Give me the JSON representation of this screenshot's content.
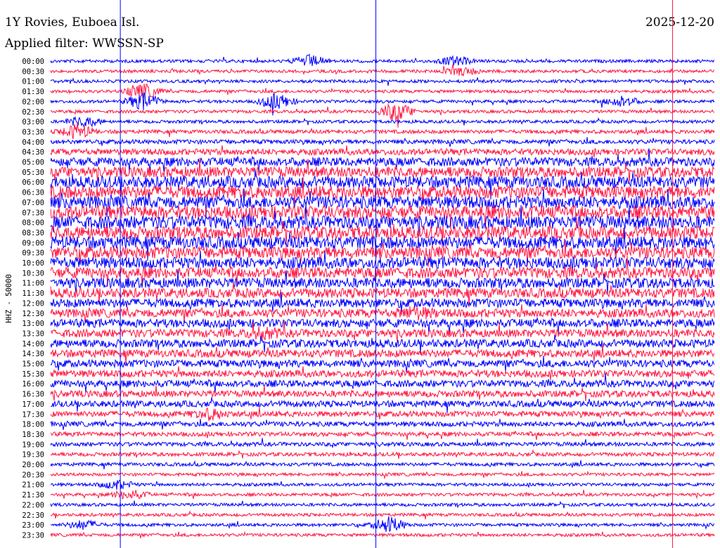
{
  "header": {
    "station": "1Y Rovies, Euboea Isl.",
    "date": "2025-12-20",
    "filter": "Applied filter: WWSSN-SP"
  },
  "chart_data": {
    "type": "line",
    "chart_kind": "helicorder",
    "title": "1Y Rovies, Euboea Isl.",
    "date": "2025-12-20",
    "filter": "Applied filter: WWSSN-SP",
    "ylabel": "HHZ - 50000",
    "grid": false,
    "trace_colors": [
      "#0000ff",
      "#ff1744"
    ],
    "tick_labels": [
      "00:00",
      "00:30",
      "01:00",
      "01:30",
      "02:00",
      "02:30",
      "03:00",
      "03:30",
      "04:00",
      "04:30",
      "05:00",
      "05:30",
      "06:00",
      "06:30",
      "07:00",
      "07:30",
      "08:00",
      "08:30",
      "09:00",
      "09:30",
      "10:00",
      "10:30",
      "11:00",
      "11:30",
      "12:00",
      "12:30",
      "13:00",
      "13:30",
      "14:00",
      "14:30",
      "15:00",
      "15:30",
      "16:00",
      "16:30",
      "17:00",
      "17:30",
      "18:00",
      "18:30",
      "19:00",
      "19:30",
      "20:00",
      "20:30",
      "21:00",
      "21:30",
      "22:00",
      "22:30",
      "23:00",
      "23:30"
    ],
    "row_amplitude": [
      1.0,
      1.0,
      1.0,
      1.0,
      1.0,
      1.0,
      1.0,
      1.2,
      1.4,
      2.0,
      2.8,
      3.4,
      3.8,
      4.0,
      4.1,
      4.2,
      4.2,
      4.1,
      4.0,
      3.9,
      3.7,
      3.5,
      3.3,
      3.1,
      2.9,
      2.8,
      2.7,
      2.6,
      2.6,
      2.5,
      2.4,
      2.3,
      2.2,
      2.1,
      2.0,
      1.8,
      1.6,
      1.4,
      1.3,
      1.2,
      1.1,
      1.0,
      1.0,
      1.0,
      1.0,
      1.0,
      1.0,
      1.0
    ],
    "events": [
      {
        "row": 0,
        "pos": 0.39,
        "strength": 2.4
      },
      {
        "row": 0,
        "pos": 0.61,
        "strength": 1.8
      },
      {
        "row": 1,
        "pos": 0.62,
        "strength": 1.6
      },
      {
        "row": 3,
        "pos": 0.14,
        "strength": 3.0
      },
      {
        "row": 4,
        "pos": 0.14,
        "strength": 3.5
      },
      {
        "row": 4,
        "pos": 0.34,
        "strength": 3.2
      },
      {
        "row": 4,
        "pos": 0.86,
        "strength": 2.2
      },
      {
        "row": 5,
        "pos": 0.52,
        "strength": 4.0
      },
      {
        "row": 6,
        "pos": 0.05,
        "strength": 2.2
      },
      {
        "row": 7,
        "pos": 0.04,
        "strength": 3.0
      },
      {
        "row": 25,
        "pos": 0.55,
        "strength": 1.8
      },
      {
        "row": 27,
        "pos": 0.32,
        "strength": 1.6
      },
      {
        "row": 35,
        "pos": 0.24,
        "strength": 2.0
      },
      {
        "row": 42,
        "pos": 0.1,
        "strength": 1.8
      },
      {
        "row": 43,
        "pos": 0.12,
        "strength": 2.0
      },
      {
        "row": 46,
        "pos": 0.05,
        "strength": 1.8
      },
      {
        "row": 46,
        "pos": 0.51,
        "strength": 3.2
      }
    ],
    "markers": [
      {
        "pos": 0.105,
        "color": "#0000ff"
      },
      {
        "pos": 0.49,
        "color": "#0000ff"
      },
      {
        "pos": 0.937,
        "color": "#ff1744"
      }
    ]
  }
}
